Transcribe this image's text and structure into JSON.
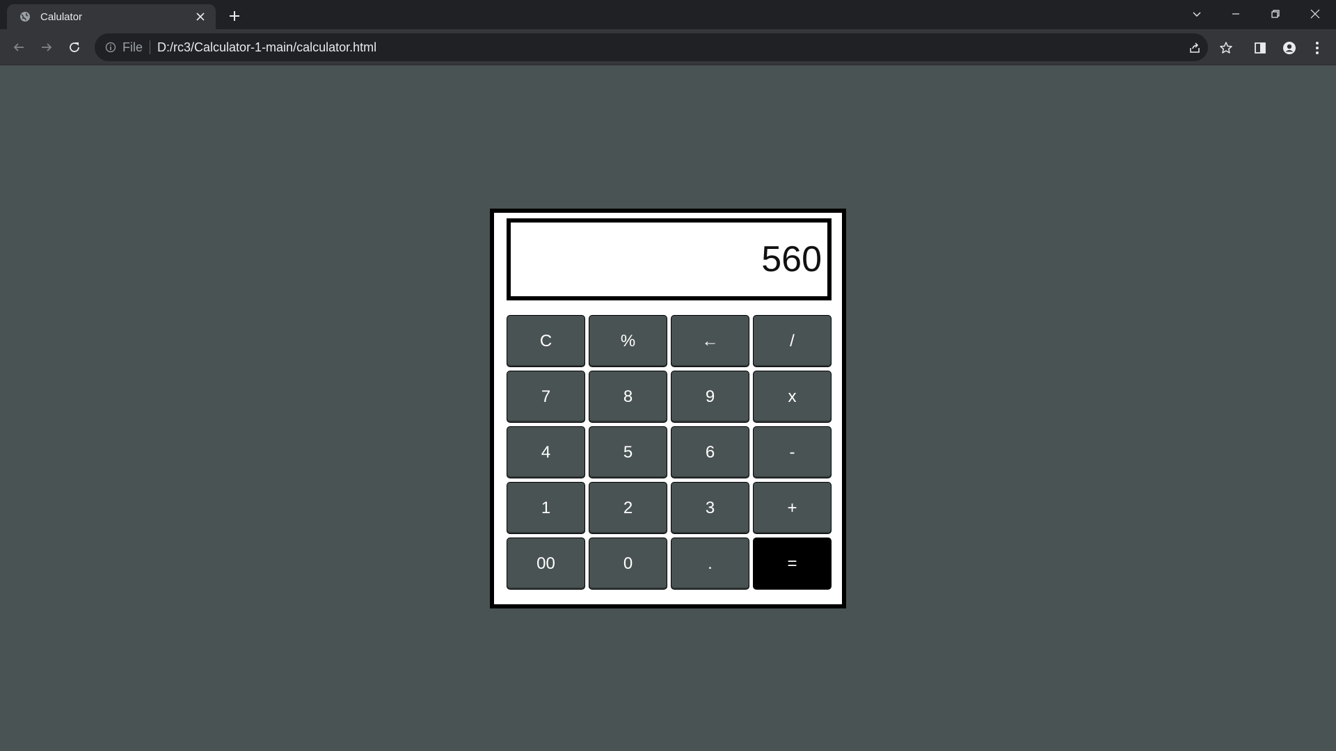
{
  "browser": {
    "tab_title": "Calulator",
    "url_scheme_label": "File",
    "url": "D:/rc3/Calculator-1-main/calculator.html",
    "icons": {
      "favicon": "globe-icon",
      "tab_close": "close-icon",
      "new_tab": "plus-icon",
      "back": "arrow-left-icon",
      "forward": "arrow-right-icon",
      "reload": "reload-icon",
      "site_info": "info-icon",
      "share": "share-icon",
      "bookmark": "star-icon",
      "side_panel": "side-panel-icon",
      "profile": "profile-icon",
      "menu": "kebab-menu-icon"
    }
  },
  "calculator": {
    "display_value": "560",
    "keys": [
      {
        "label": "C",
        "name": "clear"
      },
      {
        "label": "%",
        "name": "percent"
      },
      {
        "label": "←",
        "name": "backspace"
      },
      {
        "label": "/",
        "name": "divide"
      },
      {
        "label": "7",
        "name": "seven"
      },
      {
        "label": "8",
        "name": "eight"
      },
      {
        "label": "9",
        "name": "nine"
      },
      {
        "label": "x",
        "name": "multiply"
      },
      {
        "label": "4",
        "name": "four"
      },
      {
        "label": "5",
        "name": "five"
      },
      {
        "label": "6",
        "name": "six"
      },
      {
        "label": "-",
        "name": "subtract"
      },
      {
        "label": "1",
        "name": "one"
      },
      {
        "label": "2",
        "name": "two"
      },
      {
        "label": "3",
        "name": "three"
      },
      {
        "label": "+",
        "name": "add"
      },
      {
        "label": "00",
        "name": "double-zero"
      },
      {
        "label": "0",
        "name": "zero"
      },
      {
        "label": ".",
        "name": "decimal"
      },
      {
        "label": "=",
        "name": "equals"
      }
    ]
  },
  "colors": {
    "page_background": "#4a5353",
    "key_background": "#4a5353",
    "equals_background": "#000000",
    "calculator_background": "#ffffff"
  }
}
